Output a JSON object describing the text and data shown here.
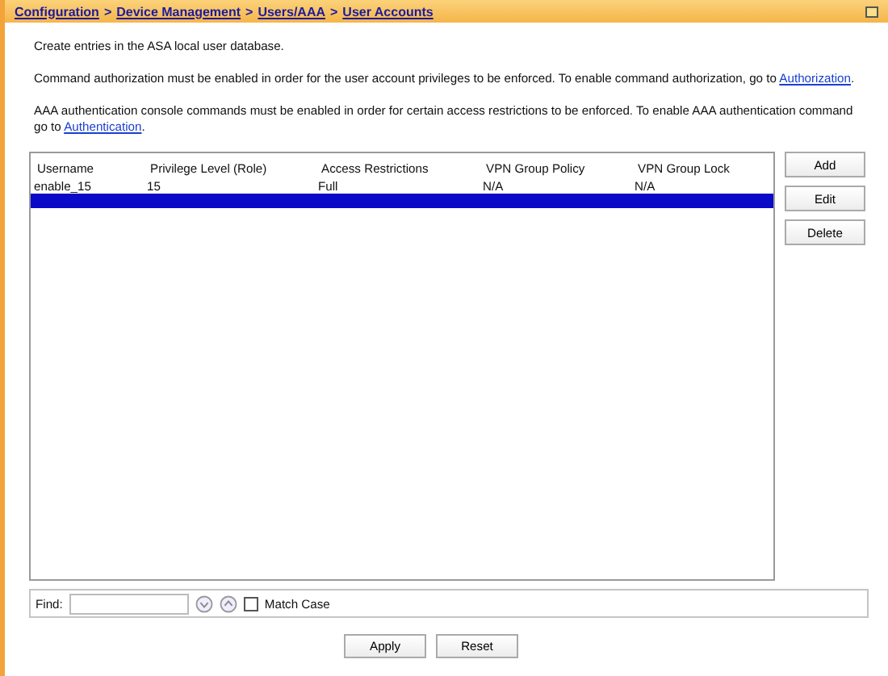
{
  "breadcrumb": [
    {
      "label": "Configuration",
      "kind": "link"
    },
    {
      "label": ">",
      "kind": "separator"
    },
    {
      "label": "Device Management",
      "kind": "link"
    },
    {
      "label": ">",
      "kind": "separator"
    },
    {
      "label": "Users/AAA",
      "kind": "link"
    },
    {
      "label": ">",
      "kind": "separator"
    },
    {
      "label": "User Accounts",
      "kind": "link"
    }
  ],
  "intro": "Create entries in the ASA local user database.",
  "notes": [
    {
      "text": "Command authorization must be enabled in order for the user account privileges to be enforced. To enable command authorization, go to",
      "link": "Authorization",
      "after": "."
    },
    {
      "text": "AAA authentication console commands must be enabled in order for certain access restrictions to be enforced. To enable AAA authentication command go to",
      "link": "Authentication",
      "after": "."
    }
  ],
  "table": {
    "columns": [
      "Username",
      "Privilege Level (Role)",
      "Access Restrictions",
      "VPN Group Policy",
      "VPN Group Lock"
    ],
    "rows": [
      {
        "selected": false,
        "cells": [
          "enable_15",
          "15",
          "Full",
          "N/A",
          "N/A"
        ]
      },
      {
        "selected": true
      }
    ]
  },
  "side_buttons": [
    "Add",
    "Edit",
    "Delete"
  ],
  "find": {
    "label": "Find:",
    "match_case": {
      "label": "Match Case",
      "checked": false
    }
  },
  "buttons": [
    "Apply",
    "Reset"
  ]
}
